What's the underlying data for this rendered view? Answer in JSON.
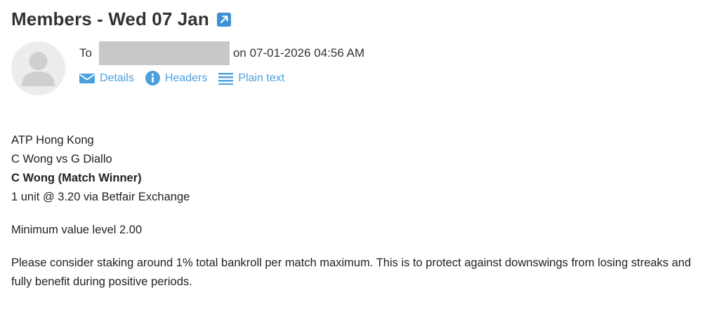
{
  "header": {
    "title": "Members - Wed 07 Jan",
    "open_icon": "external-link-icon"
  },
  "recipient": {
    "to_label": "To",
    "date_text": "on 07-01-2026 04:56 AM",
    "avatar_icon": "person-icon"
  },
  "actions": [
    {
      "label": "Details",
      "icon": "envelope-icon"
    },
    {
      "label": "Headers",
      "icon": "info-icon"
    },
    {
      "label": "Plain text",
      "icon": "lines-icon"
    }
  ],
  "message": {
    "line1": "ATP Hong Kong",
    "line2": "C Wong vs G Diallo",
    "line3": "C Wong (Match Winner)",
    "line4": "1 unit @ 3.20 via Betfair Exchange",
    "min_value": "Minimum value level 2.00",
    "advice": "Please consider staking around 1% total bankroll per match maximum. This is to protect against downswings from losing streaks and fully benefit during positive periods."
  },
  "colors": {
    "link": "#4a9fdc",
    "avatar_bg": "#ececec",
    "avatar_fg": "#cfcfcf",
    "redaction": "#c8c8c8"
  }
}
